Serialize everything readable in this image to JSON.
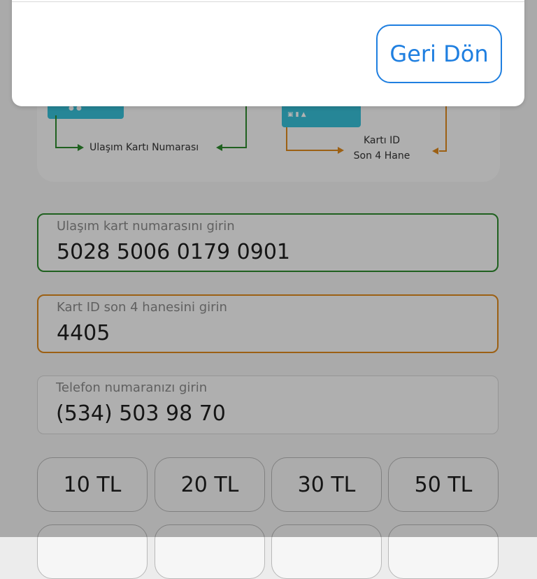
{
  "info_card": {
    "left_caption": "Ulaşım Kartı Numarası",
    "right_caption_line1": "Kartı ID",
    "right_caption_line2": "Son 4 Hane",
    "colors": {
      "green": "#2e8b2e",
      "orange": "#e08a1e",
      "card": "#37c1d9"
    }
  },
  "fields": {
    "card_number": {
      "label": "Ulaşım kart numarasını girin",
      "value": "5028 5006 0179 0901"
    },
    "card_id": {
      "label": "Kart ID son 4 hanesini girin",
      "value": "4405"
    },
    "phone": {
      "label": "Telefon numaranızı girin",
      "value": "(534) 503 98 70"
    }
  },
  "amounts": [
    "10 TL",
    "20 TL",
    "30 TL",
    "50 TL"
  ],
  "modal": {
    "back_label": "Geri Dön",
    "accent": "#1f7fe0"
  }
}
